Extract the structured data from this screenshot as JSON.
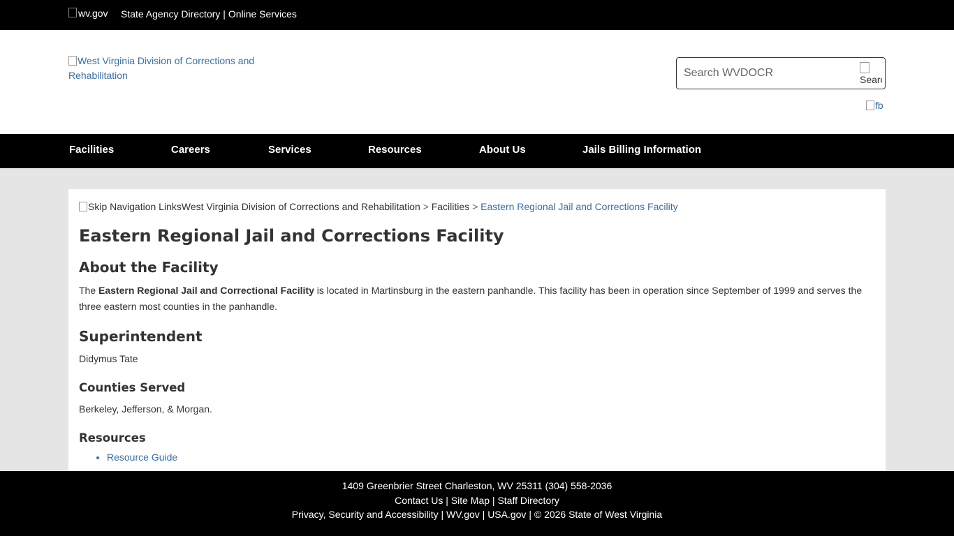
{
  "topbar": {
    "logo_alt": "wv.gov",
    "agency_directory": "State Agency Directory",
    "separator": "|",
    "online_services": "Online Services"
  },
  "header": {
    "logo_alt": "West Virginia Division of Corrections and Rehabilitation",
    "search_placeholder": "Search WVDOCR",
    "search_button_alt": "Search",
    "fb_alt": "fb"
  },
  "nav": {
    "items": [
      "Facilities",
      "Careers",
      "Services",
      "Resources",
      "About Us",
      "Jails Billing Information"
    ]
  },
  "breadcrumb": {
    "skip_alt": "Skip Navigation Links",
    "home": "West Virginia Division of Corrections and Rehabilitation",
    "sep": ">",
    "level1": "Facilities",
    "current": "Eastern Regional Jail and Corrections Facility"
  },
  "main": {
    "title": "Eastern Regional Jail and Corrections Facility",
    "about_heading": "About the Facility",
    "about_pre": "The ",
    "about_bold": "Eastern Regional Jail and Correctional Facility",
    "about_post": " is located in Martinsburg in the eastern panhandle. This facility has been in operation since September of 1999 and serves the three eastern most counties in the panhandle.",
    "superintendent_heading": "Superintendent",
    "superintendent_name": "Didymus Tate",
    "counties_heading": "Counties Served",
    "counties_text": "Berkeley, Jefferson, & Morgan.",
    "resources_heading": "Resources",
    "resources": [
      "Resource Guide"
    ]
  },
  "footer": {
    "address": "1409 Greenbrier Street Charleston, WV 25311 (304) 558-2036",
    "contact": "Contact Us",
    "sitemap": "Site Map",
    "staff": "Staff Directory",
    "privacy": "Privacy, Security and Accessibility",
    "wvgov": "WV.gov",
    "usagov": "USA.gov",
    "copyright": "© 2026 State of West Virginia",
    "sep": "|"
  },
  "colors": {
    "bar_background": "#000000",
    "link": "#3a6ea5",
    "page_background": "#e5e5e5"
  }
}
